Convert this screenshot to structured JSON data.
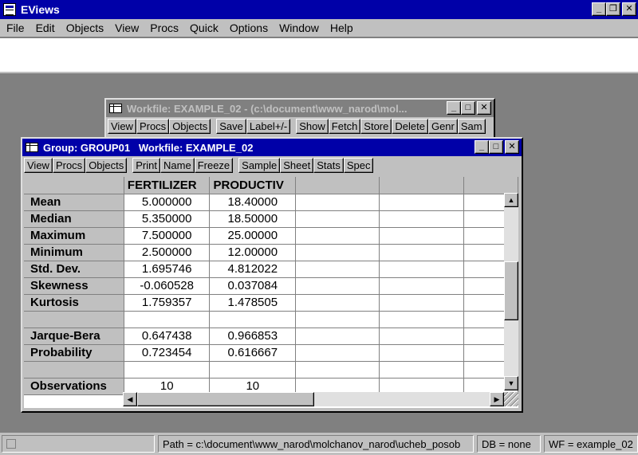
{
  "app": {
    "title": "EViews"
  },
  "menu": [
    "File",
    "Edit",
    "Objects",
    "View",
    "Procs",
    "Quick",
    "Options",
    "Window",
    "Help"
  ],
  "workfile_window": {
    "title": "Workfile: EXAMPLE_02 - (c:\\document\\www_narod\\mol...",
    "toolbar": [
      "View",
      "Procs",
      "Objects",
      "Save",
      "Label+/-",
      "Show",
      "Fetch",
      "Store",
      "Delete",
      "Genr",
      "Sam"
    ]
  },
  "group_window": {
    "title": "Group: GROUP01   Workfile: EXAMPLE_02",
    "toolbar": [
      "View",
      "Procs",
      "Objects",
      "Print",
      "Name",
      "Freeze",
      "Sample",
      "Sheet",
      "Stats",
      "Spec"
    ],
    "columns": [
      "FERTILIZER",
      "PRODUCTIV"
    ],
    "rows": [
      {
        "label": "Mean",
        "values": [
          "5.000000",
          "18.40000"
        ]
      },
      {
        "label": "Median",
        "values": [
          "5.350000",
          "18.50000"
        ]
      },
      {
        "label": "Maximum",
        "values": [
          "7.500000",
          "25.00000"
        ]
      },
      {
        "label": "Minimum",
        "values": [
          "2.500000",
          "12.00000"
        ]
      },
      {
        "label": "Std. Dev.",
        "values": [
          "1.695746",
          "4.812022"
        ]
      },
      {
        "label": "Skewness",
        "values": [
          "-0.060528",
          "0.037084"
        ]
      },
      {
        "label": "Kurtosis",
        "values": [
          "1.759357",
          "1.478505"
        ]
      },
      {
        "label": "",
        "values": [
          "",
          ""
        ]
      },
      {
        "label": "Jarque-Bera",
        "values": [
          "0.647438",
          "0.966853"
        ]
      },
      {
        "label": "Probability",
        "values": [
          "0.723454",
          "0.616667"
        ]
      },
      {
        "label": "",
        "values": [
          "",
          ""
        ]
      },
      {
        "label": "Observations",
        "values": [
          "10",
          "10"
        ]
      }
    ]
  },
  "status": {
    "path": "Path = c:\\document\\www_narod\\molchanov_narod\\ucheb_posob",
    "db": "DB = none",
    "wf": "WF = example_02"
  },
  "colors": {
    "title_active": "#0000a8",
    "title_inactive": "#808080",
    "chrome": "#c0c0c0",
    "desktop": "#808080"
  }
}
